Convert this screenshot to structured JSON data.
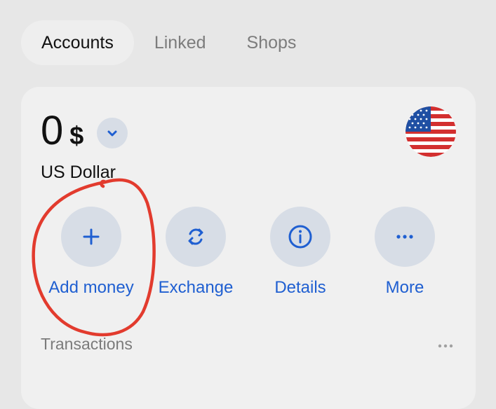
{
  "tabs": [
    {
      "label": "Accounts",
      "active": true
    },
    {
      "label": "Linked",
      "active": false
    },
    {
      "label": "Shops",
      "active": false
    }
  ],
  "account": {
    "balance": "0",
    "currency_symbol": "$",
    "currency_name": "US Dollar",
    "dropdown_icon": "chevron-down-icon",
    "flag_icon": "us-flag-icon"
  },
  "actions": [
    {
      "label": "Add money",
      "icon": "plus-icon"
    },
    {
      "label": "Exchange",
      "icon": "exchange-icon"
    },
    {
      "label": "Details",
      "icon": "info-icon"
    },
    {
      "label": "More",
      "icon": "more-icon"
    }
  ],
  "transactions": {
    "label": "Transactions",
    "more_icon": "more-icon"
  },
  "colors": {
    "accent": "#1f5fd1",
    "annotation": "#e23b2e",
    "button_bg": "#d7dde6",
    "card_bg": "#f0f0f0",
    "page_bg": "#e7e7e7"
  }
}
